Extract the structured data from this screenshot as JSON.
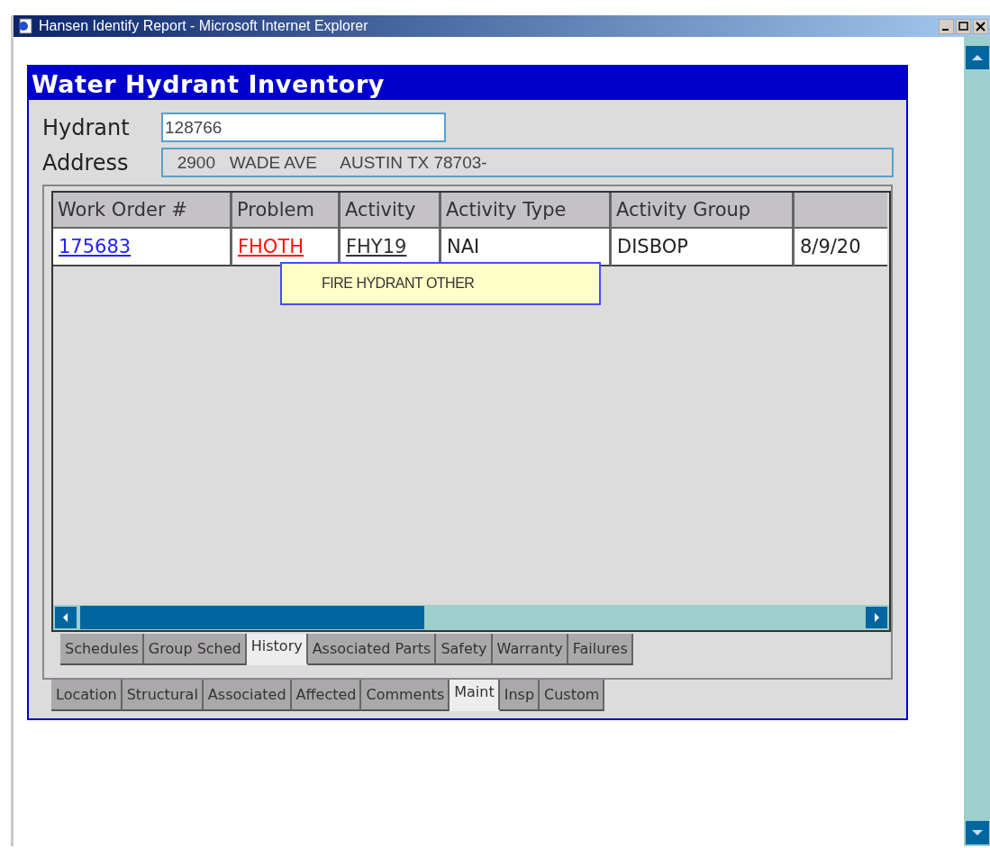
{
  "window": {
    "title": "Hansen Identify Report - Microsoft Internet Explorer"
  },
  "page": {
    "title": "Water Hydrant Inventory"
  },
  "fields": [
    {
      "label": "Hydrant",
      "value": "128766",
      "kind": "input"
    },
    {
      "label": "Address",
      "value": "2900   WADE AVE     AUSTIN TX 78703-",
      "kind": "readonly"
    }
  ],
  "table": {
    "columns": [
      "Work Order #",
      "Problem",
      "Activity",
      "Activity Type",
      "Activity Group"
    ],
    "rows": [
      {
        "cells": [
          {
            "text": "175683",
            "kind": "link"
          },
          {
            "text": "FHOTH",
            "kind": "alert-link"
          },
          {
            "text": "FHY19",
            "kind": "underlined"
          },
          {
            "text": "NAI",
            "kind": "plain"
          },
          {
            "text": "DISBOP",
            "kind": "plain"
          },
          {
            "text": "8/9/20",
            "kind": "plain"
          }
        ]
      }
    ]
  },
  "tooltip": {
    "text": "FIRE HYDRANT OTHER"
  },
  "inner_tabs": [
    {
      "label": "Schedules",
      "selected": false
    },
    {
      "label": "Group Sched",
      "selected": false
    },
    {
      "label": "History",
      "selected": true
    },
    {
      "label": "Associated Parts",
      "selected": false
    },
    {
      "label": "Safety",
      "selected": false
    },
    {
      "label": "Warranty",
      "selected": false
    },
    {
      "label": "Failures",
      "selected": false
    }
  ],
  "outer_tabs": [
    {
      "label": "Location",
      "selected": false
    },
    {
      "label": "Structural",
      "selected": false
    },
    {
      "label": "Associated",
      "selected": false
    },
    {
      "label": "Affected",
      "selected": false
    },
    {
      "label": "Comments",
      "selected": false
    },
    {
      "label": "Maint",
      "selected": true
    },
    {
      "label": "Insp",
      "selected": false
    },
    {
      "label": "Custom",
      "selected": false
    }
  ]
}
